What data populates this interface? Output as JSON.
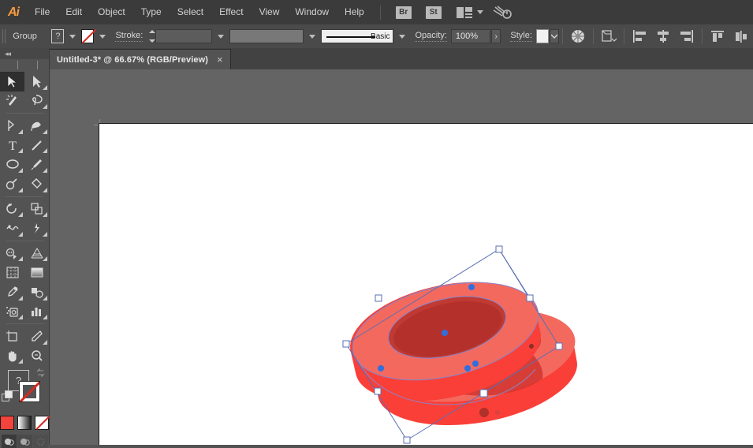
{
  "app": {
    "name": "Adobe Illustrator",
    "logo_text": "Ai"
  },
  "menubar": {
    "items": [
      {
        "label": "File"
      },
      {
        "label": "Edit"
      },
      {
        "label": "Object"
      },
      {
        "label": "Type"
      },
      {
        "label": "Select"
      },
      {
        "label": "Effect"
      },
      {
        "label": "View"
      },
      {
        "label": "Window"
      },
      {
        "label": "Help"
      }
    ],
    "bridge_label": "Br",
    "stock_label": "St",
    "arrange_icon": "arrange-documents-icon",
    "chevron_icon": "chevron-down-icon",
    "comet_icon": "comet-icon"
  },
  "controlbar": {
    "selection_label": "Group",
    "fill_swatch_value": "?",
    "fill_icon": "fill-swatch-mixed",
    "stroke_swatch_value": "None",
    "stroke_icon": "stroke-swatch-none",
    "stroke_label": "Stroke:",
    "stroke_weight_value": "",
    "stroke_profile_value": "",
    "brush_label": "Basic",
    "opacity_label": "Opacity:",
    "opacity_value": "100%",
    "opacity_more": "›",
    "style_label": "Style:",
    "style_swatch": "white-swatch",
    "recolor_icon": "recolor-artwork-icon",
    "transform_icon": "transform-panel-icon",
    "align_icons": [
      "align-left-icon",
      "align-horizontal-center-icon",
      "align-right-icon",
      "distribute-top-icon",
      "distribute-vertical-center-icon"
    ]
  },
  "tab": {
    "title": "Untitled-3* @ 66.67% (RGB/Preview)",
    "close_label": "×"
  },
  "toolbar": {
    "collapse_icon": "double-chevron-left-icon",
    "tools": [
      {
        "name": "selection-tool",
        "active": true
      },
      {
        "name": "direct-selection-tool",
        "active": false
      },
      {
        "name": "magic-wand-tool",
        "active": false
      },
      {
        "name": "lasso-tool",
        "active": false
      },
      {
        "name": "pen-tool",
        "active": false
      },
      {
        "name": "curvature-tool",
        "active": false
      },
      {
        "name": "type-tool",
        "active": false
      },
      {
        "name": "line-segment-tool",
        "active": false
      },
      {
        "name": "ellipse-tool",
        "active": false
      },
      {
        "name": "paintbrush-tool",
        "active": false
      },
      {
        "name": "shaper-tool",
        "active": false
      },
      {
        "name": "eraser-tool",
        "active": false
      },
      {
        "name": "rotate-tool",
        "active": false
      },
      {
        "name": "scale-tool",
        "active": false
      },
      {
        "name": "width-tool",
        "active": false
      },
      {
        "name": "free-transform-tool",
        "active": false
      },
      {
        "name": "shape-builder-tool",
        "active": false
      },
      {
        "name": "perspective-grid-tool",
        "active": false
      },
      {
        "name": "mesh-tool",
        "active": false
      },
      {
        "name": "gradient-tool",
        "active": false
      },
      {
        "name": "eyedropper-tool",
        "active": false
      },
      {
        "name": "blend-tool",
        "active": false
      },
      {
        "name": "symbol-sprayer-tool",
        "active": false
      },
      {
        "name": "column-graph-tool",
        "active": false
      },
      {
        "name": "artboard-tool",
        "active": false
      },
      {
        "name": "slice-tool",
        "active": false
      },
      {
        "name": "hand-tool",
        "active": false
      },
      {
        "name": "zoom-tool",
        "active": false
      }
    ],
    "fill_value": "?",
    "stroke_value": "None",
    "swatch_color_hex": "#f4433c",
    "swatch_modes": [
      "color-swatch",
      "gradient-swatch",
      "none-swatch"
    ],
    "screen_modes": [
      "drawing-mode-normal",
      "drawing-mode-behind",
      "drawing-mode-inside"
    ]
  },
  "canvas": {
    "background_hex": "#646464",
    "artboard_hex": "#ffffff",
    "zoom_level": "66.67%"
  },
  "artwork": {
    "title": "Two 3D red blood cell discs",
    "colors": {
      "rim_top": "#f4695e",
      "rim_side": "#f93f38",
      "dimple": "#c03a33",
      "dimple_dark": "#b3302b",
      "shadow": "#d8322c"
    },
    "selection": {
      "box_stroke_hex": "#5a6fb5",
      "handle_fill_hex": "#ffffff",
      "anchor_fill_hex": "#2f6fe0",
      "handles": 8,
      "anchors": 6
    }
  }
}
